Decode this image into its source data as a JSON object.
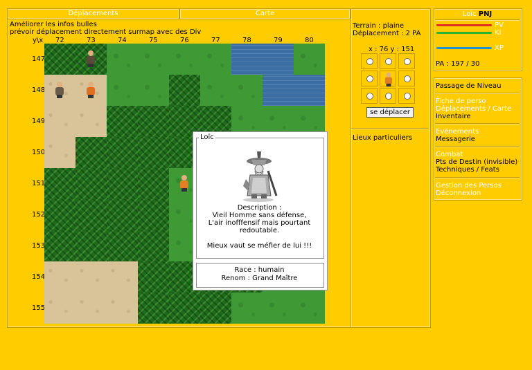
{
  "tabs": {
    "deplacements": "Déplacements",
    "carte": "Carte"
  },
  "notes": {
    "line1": "Améliorer les infos bulles",
    "line2": "prévoir déplacement directement surmap avec des Div"
  },
  "axis": {
    "corner": "y\\x",
    "x": [
      "72",
      "73",
      "74",
      "75",
      "76",
      "77",
      "78",
      "79",
      "80"
    ],
    "y": [
      "147",
      "148",
      "149",
      "150",
      "151",
      "152",
      "153",
      "154",
      "155"
    ]
  },
  "map": {
    "rows": [
      [
        "forest",
        "forest",
        "plain",
        "plain",
        "plain",
        "plain",
        "water",
        "water",
        "plain"
      ],
      [
        "sand",
        "sand",
        "plain",
        "plain",
        "forest",
        "plain",
        "plain",
        "water",
        "water"
      ],
      [
        "sand",
        "sand",
        "forest",
        "forest",
        "forest",
        "forest",
        "plain",
        "plain",
        "plain"
      ],
      [
        "sand",
        "forest",
        "forest",
        "forest",
        "forest",
        "forest",
        "plain",
        "plain",
        "plain"
      ],
      [
        "forest",
        "forest",
        "forest",
        "forest",
        "plain",
        "forest",
        "plain",
        "plain",
        "plain"
      ],
      [
        "forest",
        "forest",
        "forest",
        "forest",
        "plain",
        "forest",
        "forest",
        "plain",
        "plain"
      ],
      [
        "forest",
        "forest",
        "forest",
        "forest",
        "plain",
        "forest",
        "forest",
        "plain",
        "plain"
      ],
      [
        "sand",
        "sand",
        "sand",
        "forest",
        "forest",
        "forest",
        "forest",
        "plain",
        "plain"
      ],
      [
        "sand",
        "sand",
        "sand",
        "forest",
        "forest",
        "forest",
        "plain",
        "plain",
        "plain"
      ]
    ],
    "characters": [
      {
        "col": 1,
        "row": 0,
        "body": "#5a4a3a",
        "name": "npc-old"
      },
      {
        "col": 0,
        "row": 1,
        "body": "#6a5a48",
        "name": "npc-bandit"
      },
      {
        "col": 1,
        "row": 1,
        "body": "#e07020",
        "name": "npc-monk"
      },
      {
        "col": 4,
        "row": 4,
        "body": "#e08020",
        "name": "player"
      }
    ]
  },
  "popup": {
    "legend": "Loïc",
    "desc_title": "Description :",
    "desc_l1": "Vieil Homme sans défense,",
    "desc_l2": "L'air inofffensif mais pourtant",
    "desc_l3": "redoutable.",
    "desc_l4": "Mieux vaut se méfier de lui !!!",
    "race": "Race : humain",
    "renom": "Renom : Grand Maître"
  },
  "middle": {
    "terrain": "Terrain : plaine",
    "deplacement": "Déplacement : 2 PA",
    "coords": "x : 76 y : 151",
    "move_button": "se déplacer",
    "lieux": "Lieux particuliers"
  },
  "stats": {
    "name": "Loïc",
    "tag": "PNJ",
    "pv": "PV",
    "ki": "KI",
    "xp": "XP",
    "pa": "PA : 197 / 30"
  },
  "menu": {
    "passage": "Passage de Niveau",
    "fiche": "Fiche de perso",
    "depl_carte": "Déplacements / Carte",
    "inventaire": "Inventaire",
    "evenements": "Evénements",
    "messagerie": "Messagerie",
    "combat": "Combat",
    "pts_destin": "Pts de Destin (invisible)",
    "techniques": "Techniques / Feats",
    "gestion": "Gestion des Persos",
    "deconnexion": "Déconnexion"
  },
  "colors": {
    "background": "#ffcc00",
    "pv_bar": "#e03020",
    "ki_bar": "#30b030",
    "xp_bar": "#2090d0"
  }
}
